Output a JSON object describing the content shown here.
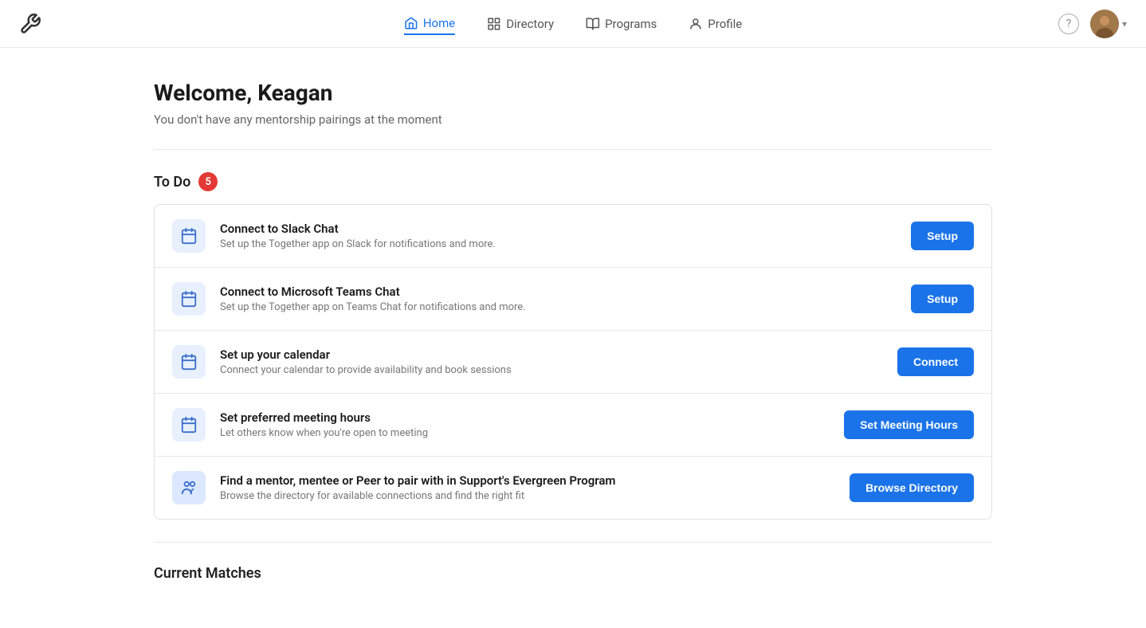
{
  "app": {
    "logo_icon": "tool-icon"
  },
  "nav": {
    "items": [
      {
        "id": "home",
        "label": "Home",
        "active": true
      },
      {
        "id": "directory",
        "label": "Directory",
        "active": false
      },
      {
        "id": "programs",
        "label": "Programs",
        "active": false
      },
      {
        "id": "profile",
        "label": "Profile",
        "active": false
      }
    ]
  },
  "header": {
    "help_label": "?",
    "chevron": "▾"
  },
  "welcome": {
    "title": "Welcome, Keagan",
    "subtitle": "You don't have any mentorship pairings at the moment"
  },
  "todo": {
    "label": "To Do",
    "count": "5",
    "tasks": [
      {
        "id": "slack",
        "title": "Connect to Slack Chat",
        "desc": "Set up the Together app on Slack for notifications and more.",
        "button": "Setup",
        "icon": "calendar-icon"
      },
      {
        "id": "teams",
        "title": "Connect to Microsoft Teams Chat",
        "desc": "Set up the Together app on Teams Chat for notifications and more.",
        "button": "Setup",
        "icon": "calendar-icon"
      },
      {
        "id": "calendar",
        "title": "Set up your calendar",
        "desc": "Connect your calendar to provide availability and book sessions",
        "button": "Connect",
        "icon": "calendar-icon"
      },
      {
        "id": "meeting-hours",
        "title": "Set preferred meeting hours",
        "desc": "Let others know when you're open to meeting",
        "button": "Set Meeting Hours",
        "icon": "calendar-icon"
      },
      {
        "id": "directory",
        "title": "Find a mentor, mentee or Peer to pair with in Support's Evergreen Program",
        "desc": "Browse the directory for available connections and find the right fit",
        "button": "Browse Directory",
        "icon": "people-icon"
      }
    ]
  },
  "current_matches": {
    "label": "Current Matches"
  }
}
